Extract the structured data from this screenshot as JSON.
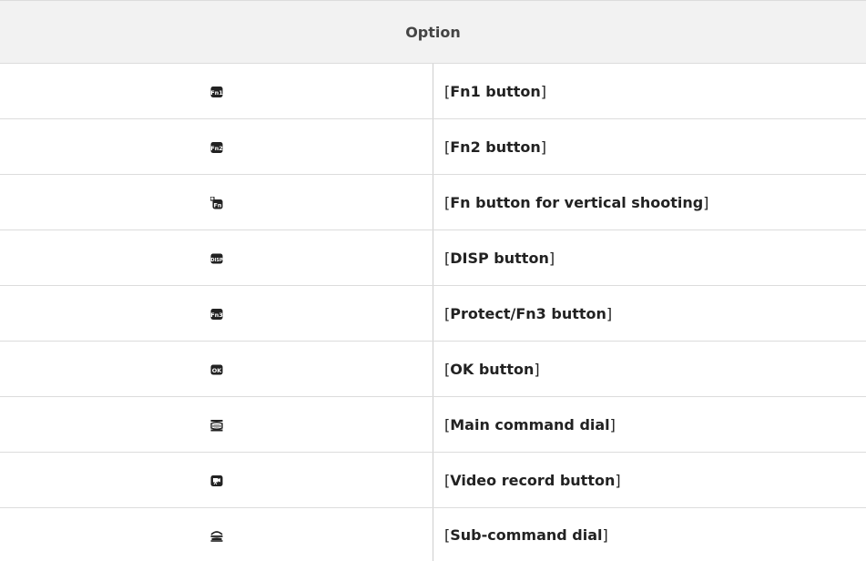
{
  "table": {
    "header": "Option",
    "rows": [
      {
        "icon": "fn1-button-icon",
        "icon_text": "Fn1",
        "label": "Fn1 button"
      },
      {
        "icon": "fn2-button-icon",
        "icon_text": "Fn2",
        "label": "Fn2 button"
      },
      {
        "icon": "vertical-fn-button-icon",
        "icon_text": "Fn",
        "label": "Fn button for vertical shooting"
      },
      {
        "icon": "disp-button-icon",
        "icon_text": "DISP",
        "label": "DISP button"
      },
      {
        "icon": "fn3-button-icon",
        "icon_text": "Fn3",
        "label": "Protect/Fn3 button"
      },
      {
        "icon": "ok-button-icon",
        "icon_text": "OK",
        "label": "OK button"
      },
      {
        "icon": "main-command-dial-icon",
        "icon_text": "",
        "label": "Main command dial"
      },
      {
        "icon": "video-record-button-icon",
        "icon_text": "",
        "label": "Video record button"
      },
      {
        "icon": "sub-command-dial-icon",
        "icon_text": "",
        "label": "Sub-command dial"
      }
    ]
  },
  "colors": {
    "header_bg": "#f2f2f2",
    "border": "#dcdcdc",
    "icon_fill": "#222222"
  }
}
